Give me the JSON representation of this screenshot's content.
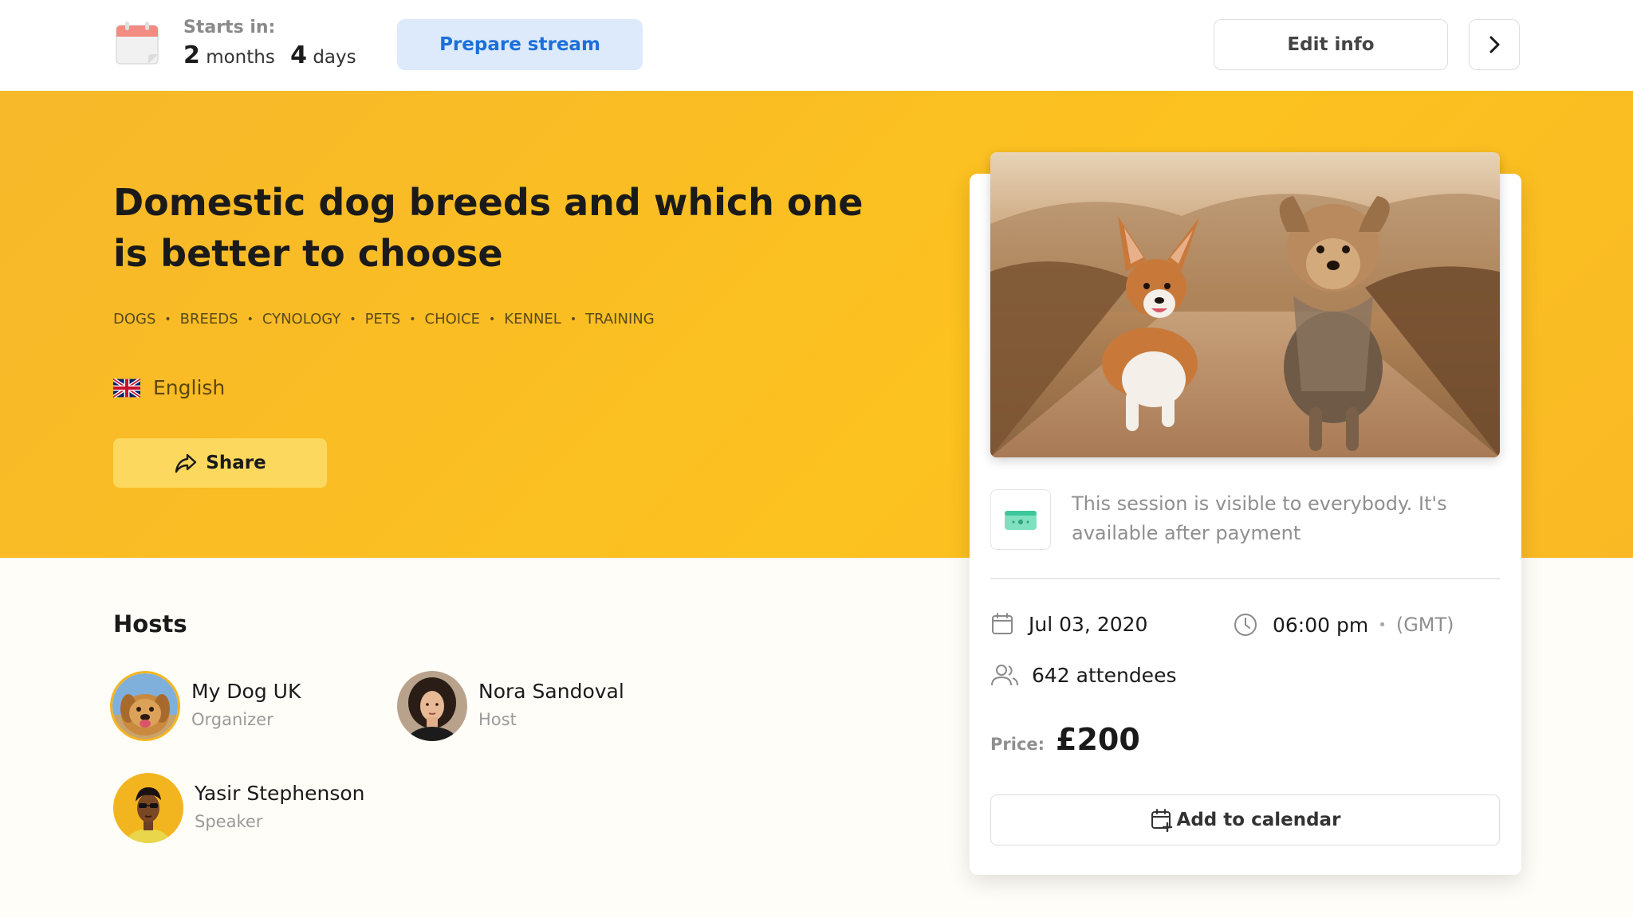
{
  "topbar": {
    "calendar_icon": "calendar-icon",
    "starts_label": "Starts in:",
    "countdown": {
      "months_value": "2",
      "months_unit": "months",
      "days_value": "4",
      "days_unit": "days"
    },
    "prepare_stream_label": "Prepare stream",
    "edit_info_label": "Edit info",
    "next_icon": "chevron-right-icon"
  },
  "hero": {
    "title": "Domestic dog breeds and which one is better to choose",
    "tags": [
      "DOGS",
      "BREEDS",
      "CYNOLOGY",
      "PETS",
      "CHOICE",
      "KENNEL",
      "TRAINING"
    ],
    "language": {
      "flag_icon": "uk-flag-icon",
      "label": "English"
    },
    "share_label": "Share",
    "background_color": "#fcc21f"
  },
  "hosts": {
    "heading": "Hosts",
    "items": [
      {
        "name": "My Dog UK",
        "role": "Organizer"
      },
      {
        "name": "Nora Sandoval",
        "role": "Host"
      },
      {
        "name": "Yasir Stephenson",
        "role": "Speaker"
      }
    ]
  },
  "card": {
    "visibility_icon": "money-icon",
    "visibility_text": "This session is visible to everybody. It's available after payment",
    "date": "Jul 03, 2020",
    "time": "06:00 pm",
    "timezone": "(GMT)",
    "attendees": "642 attendees",
    "price_label": "Price:",
    "price_value": "£200",
    "add_to_calendar_label": "Add to calendar"
  },
  "colors": {
    "accent_blue": "#1d6fd8",
    "hero_yellow": "#fcc21f",
    "money_green": "#3cc79a"
  }
}
